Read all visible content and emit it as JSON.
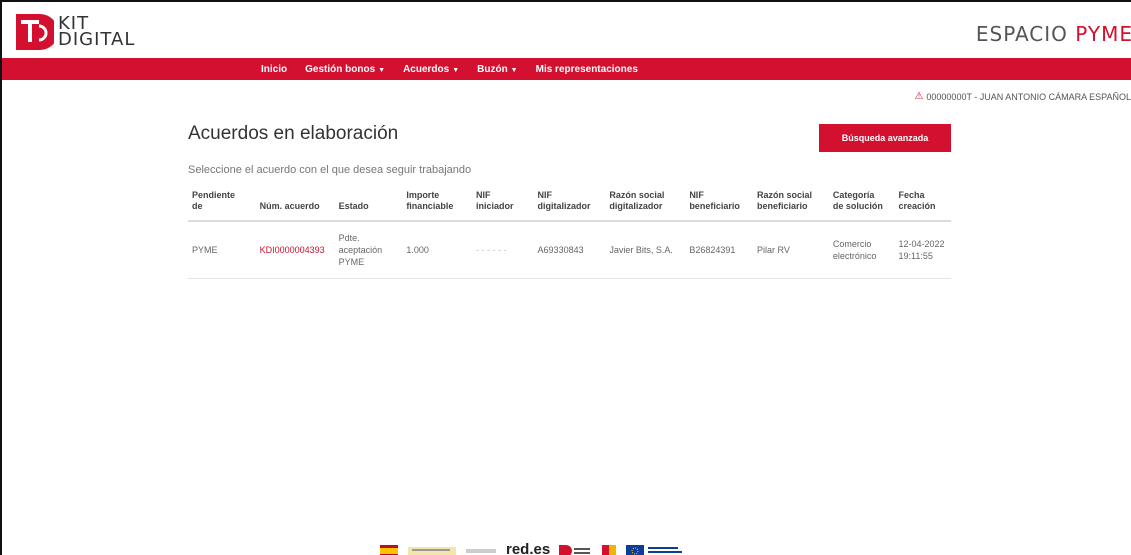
{
  "logo": {
    "line1": "KIT",
    "line2": "DIGITAL"
  },
  "brand": {
    "prefix": "ESPACIO ",
    "accent": "PYME"
  },
  "nav": [
    {
      "label": "Inicio",
      "dropdown": false
    },
    {
      "label": "Gestión bonos",
      "dropdown": true
    },
    {
      "label": "Acuerdos",
      "dropdown": true
    },
    {
      "label": "Buzón",
      "dropdown": true
    },
    {
      "label": "Mis representaciones",
      "dropdown": false
    }
  ],
  "user": {
    "text": "00000000T - JUAN ANTONIO CÁMARA ESPAÑOL"
  },
  "page": {
    "title": "Acuerdos en elaboración",
    "subtitle": "Seleccione el acuerdo con el que desea seguir trabajando",
    "advanced_search": "Búsqueda avanzada"
  },
  "table": {
    "headers": [
      "Pendiente de",
      "Núm. acuerdo",
      "Estado",
      "Importe financiable",
      "NIF iniciador",
      "NIF digitalizador",
      "Razón social digitalizador",
      "NIF beneficiario",
      "Razón social beneficiario",
      "Categoría de solución",
      "Fecha creación"
    ],
    "rows": [
      [
        "PYME",
        "KDI0000004393",
        "Pdte. aceptación PYME",
        "1.000",
        "- - - - - -",
        "A69330843",
        "Javier Bits, S.A.",
        "B26824391",
        "Pilar RV",
        "Comercio electrónico",
        "12-04-2022 19:11:55"
      ]
    ]
  },
  "footer": {
    "red": "red.es"
  },
  "colors": {
    "accent": "#d3102f"
  }
}
